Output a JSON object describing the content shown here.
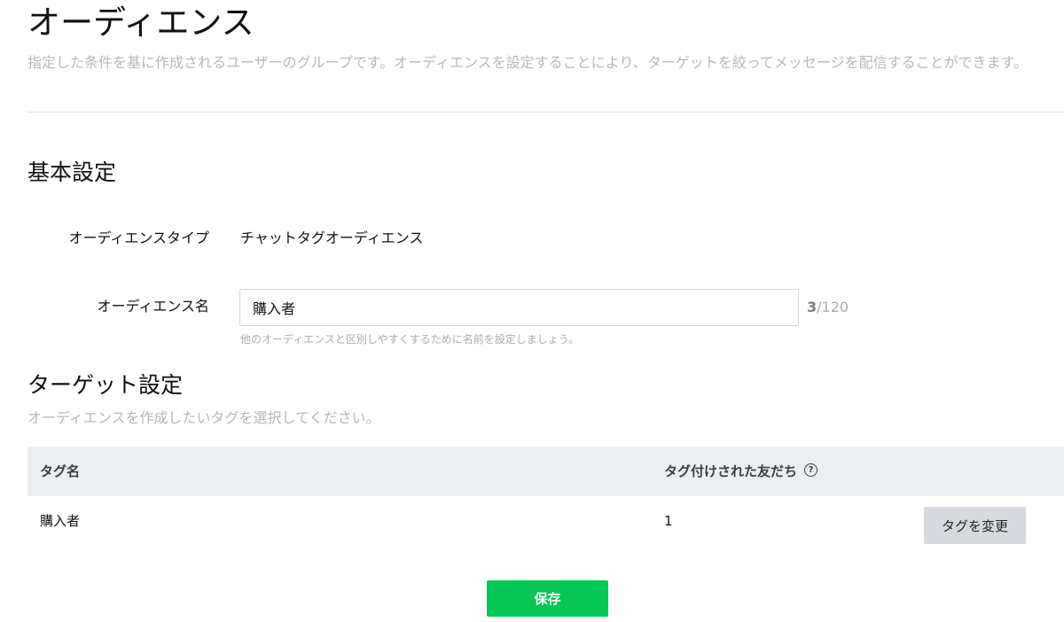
{
  "header": {
    "title": "オーディエンス",
    "description": "指定した条件を基に作成されるユーザーのグループです。オーディエンスを設定することにより、ターゲットを絞ってメッセージを配信することができます。"
  },
  "basic_settings": {
    "title": "基本設定",
    "type_label": "オーディエンスタイプ",
    "type_value": "チャットタグオーディエンス",
    "name_label": "オーディエンス名",
    "name_value": "購入者",
    "char_count": "3",
    "char_max": "/120",
    "name_help": "他のオーディエンスと区別しやすくするために名前を設定しましょう。"
  },
  "target_settings": {
    "title": "ターゲット設定",
    "description": "オーディエンスを作成したいタグを選択してください。",
    "table": {
      "columns": [
        "タグ名",
        "タグ付けされた友だち"
      ],
      "help_icon": "?",
      "rows": [
        {
          "tag_name": "購入者",
          "friend_count": "1"
        }
      ],
      "change_tag_label": "タグを変更"
    }
  },
  "footer": {
    "save_label": "保存"
  },
  "colors": {
    "primary_green": "#06c755",
    "muted_text": "#b5b7bd",
    "table_header_bg": "#eceef0",
    "secondary_button_bg": "#d6d9de"
  }
}
